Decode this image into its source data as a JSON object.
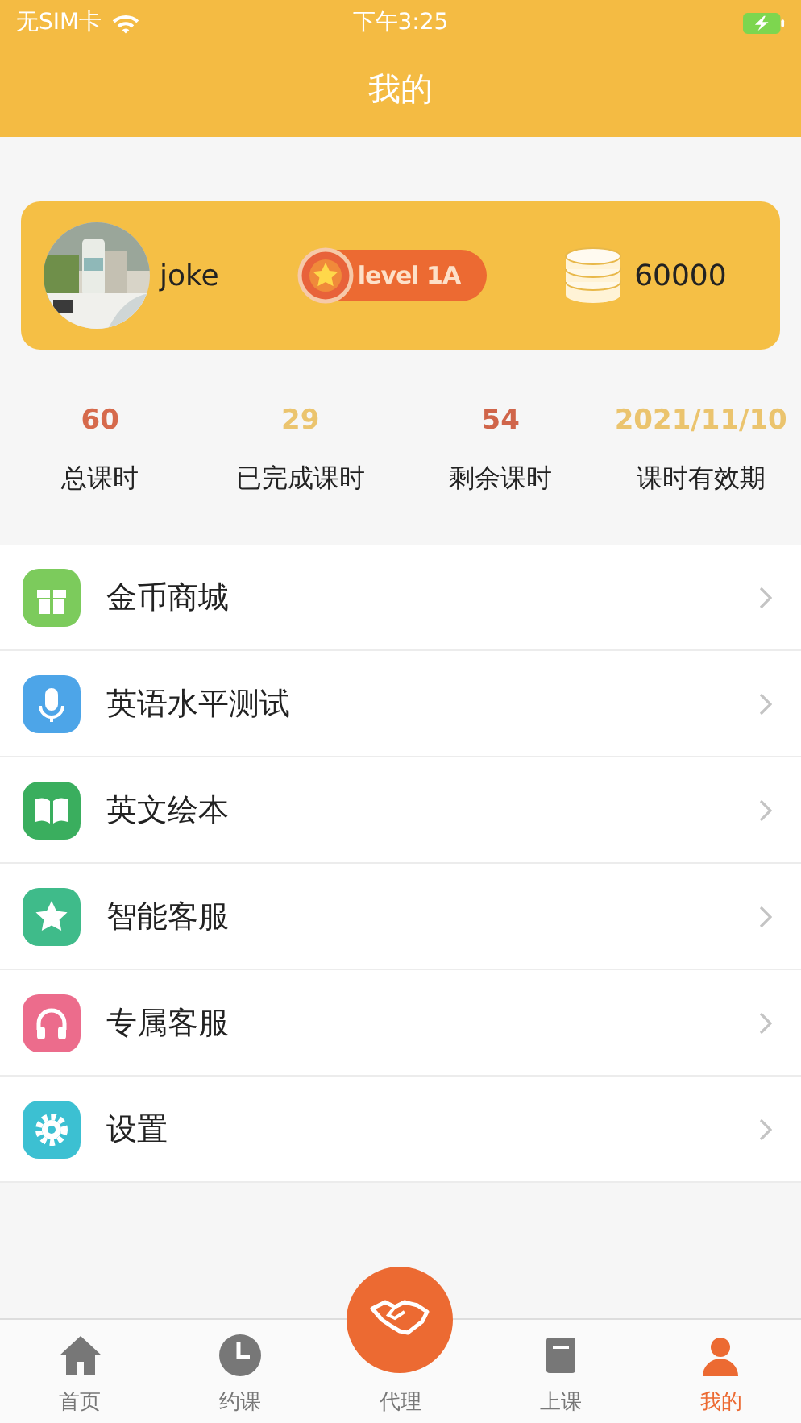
{
  "status_bar": {
    "carrier": "无SIM卡",
    "time": "下午3:25"
  },
  "title": "我的",
  "profile": {
    "name": "joke",
    "level": "level 1A",
    "coins": "60000"
  },
  "stats": [
    {
      "value": "60",
      "label": "总课时",
      "color": "#d66a4c"
    },
    {
      "value": "29",
      "label": "已完成课时",
      "color": "#ebc46e"
    },
    {
      "value": "54",
      "label": "剩余课时",
      "color": "#d0654a"
    },
    {
      "value": "2021/11/10",
      "label": "课时有效期",
      "color": "#ebc46e"
    }
  ],
  "menu": [
    {
      "label": "金币商城",
      "color": "#7ccb5c"
    },
    {
      "label": "英语水平测试",
      "color": "#4da5e8"
    },
    {
      "label": "英文绘本",
      "color": "#3aae5e"
    },
    {
      "label": "智能客服",
      "color": "#3fbb8a"
    },
    {
      "label": "专属客服",
      "color": "#ec6c8c"
    },
    {
      "label": "设置",
      "color": "#3cc0d2"
    }
  ],
  "tabs": [
    {
      "label": "首页",
      "selected": false
    },
    {
      "label": "约课",
      "selected": false
    },
    {
      "label": "代理",
      "selected": false
    },
    {
      "label": "上课",
      "selected": false
    },
    {
      "label": "我的",
      "selected": true
    }
  ]
}
